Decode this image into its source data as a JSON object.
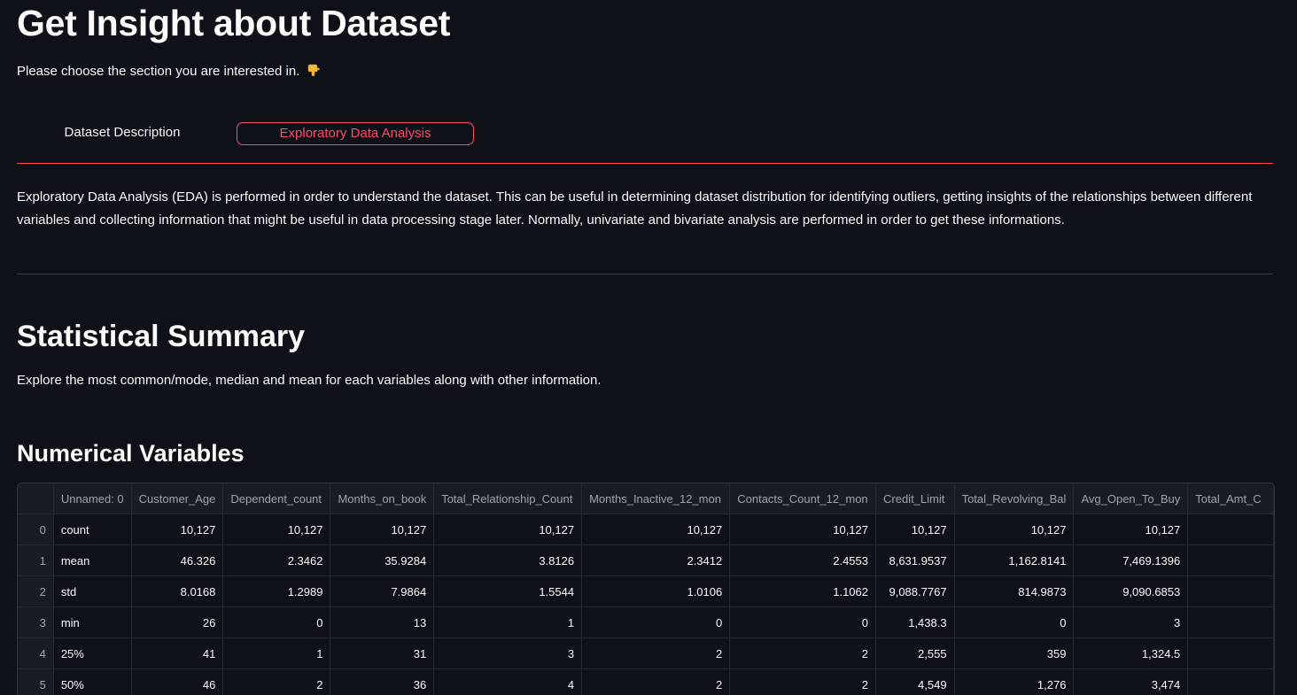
{
  "header": {
    "title": "Get Insight about Dataset",
    "intro": "Please choose the section you are interested in.",
    "intro_icon": "pointing-down-hand-icon"
  },
  "tabs": [
    {
      "label": "Dataset Description",
      "active": false
    },
    {
      "label": "Exploratory Data Analysis",
      "active": true
    }
  ],
  "eda": {
    "description": "Exploratory Data Analysis (EDA) is performed in order to understand the dataset. This can be useful in determining dataset distribution for identifying outliers, getting insights of the relationships between different variables and collecting information that might be useful in data processing stage later. Normally, univariate and bivariate analysis are performed in order to get these informations."
  },
  "summary": {
    "title": "Statistical Summary",
    "description": "Explore the most common/mode, median and mean for each variables along with other information."
  },
  "numerical": {
    "title": "Numerical Variables",
    "columns": [
      "Unnamed: 0",
      "Customer_Age",
      "Dependent_count",
      "Months_on_book",
      "Total_Relationship_Count",
      "Months_Inactive_12_mon",
      "Contacts_Count_12_mon",
      "Credit_Limit",
      "Total_Revolving_Bal",
      "Avg_Open_To_Buy",
      "Total_Amt_C"
    ],
    "rows": [
      {
        "index": "0",
        "values": [
          "count",
          "10,127",
          "10,127",
          "10,127",
          "10,127",
          "10,127",
          "10,127",
          "10,127",
          "10,127",
          "10,127",
          ""
        ]
      },
      {
        "index": "1",
        "values": [
          "mean",
          "46.326",
          "2.3462",
          "35.9284",
          "3.8126",
          "2.3412",
          "2.4553",
          "8,631.9537",
          "1,162.8141",
          "7,469.1396",
          ""
        ]
      },
      {
        "index": "2",
        "values": [
          "std",
          "8.0168",
          "1.2989",
          "7.9864",
          "1.5544",
          "1.0106",
          "1.1062",
          "9,088.7767",
          "814.9873",
          "9,090.6853",
          ""
        ]
      },
      {
        "index": "3",
        "values": [
          "min",
          "26",
          "0",
          "13",
          "1",
          "0",
          "0",
          "1,438.3",
          "0",
          "3",
          ""
        ]
      },
      {
        "index": "4",
        "values": [
          "25%",
          "41",
          "1",
          "31",
          "3",
          "2",
          "2",
          "2,555",
          "359",
          "1,324.5",
          ""
        ]
      },
      {
        "index": "5",
        "values": [
          "50%",
          "46",
          "2",
          "36",
          "4",
          "2",
          "2",
          "4,549",
          "1,276",
          "3,474",
          ""
        ]
      }
    ]
  },
  "colors": {
    "background": "#0e1117",
    "accent": "#ff4b6b",
    "text": "#fafafa"
  }
}
